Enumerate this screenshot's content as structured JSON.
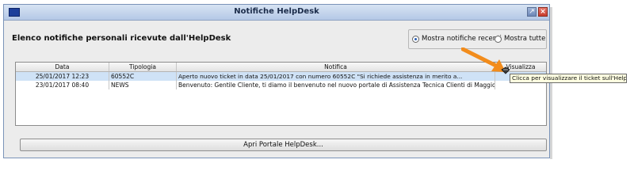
{
  "window": {
    "title": "Notifiche HelpDesk"
  },
  "heading": "Elenco notifiche personali ricevute dall'HelpDesk",
  "filter": {
    "options": [
      "Mostra notifiche recenti",
      "Mostra tutte"
    ],
    "selected": "Mostra notifiche recenti"
  },
  "table": {
    "headers": [
      "Data",
      "Tipologia",
      "Notifica",
      "Visualizza"
    ],
    "rows": [
      {
        "data": "25/01/2017 12:23",
        "tipologia": "60552C",
        "notifica": "Aperto nuovo ticket in data 25/01/2017 con numero 60552C  \"Si richiede assistenza in merito a...",
        "selected": true
      },
      {
        "data": "23/01/2017 08:40",
        "tipologia": "NEWS",
        "notifica": "Benvenuto: Gentile Cliente, ti diamo il benvenuto nel nuovo portale di Assistenza Tecnica Clienti di Maggioli",
        "selected": false
      }
    ]
  },
  "tooltip": "Clicca per visualizzare il ticket sull'HelpDesk",
  "portal_button": "Apri Portale HelpDesk...",
  "colors": {
    "arrow": "#f28c1c",
    "selection": "#cfe2f6",
    "titlebar": "#b4c8e6"
  }
}
